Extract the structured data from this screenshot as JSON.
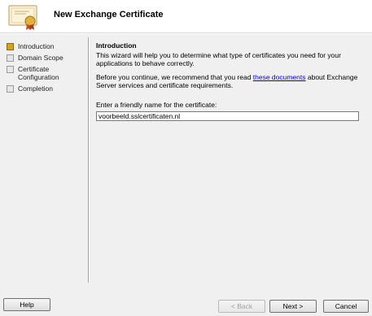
{
  "header": {
    "title": "New Exchange Certificate",
    "icon": "certificate-icon"
  },
  "steps": [
    {
      "label": "Introduction",
      "state": "current"
    },
    {
      "label": "Domain Scope",
      "state": "pending"
    },
    {
      "label": "Certificate Configuration",
      "state": "pending"
    },
    {
      "label": "Completion",
      "state": "pending"
    }
  ],
  "content": {
    "title": "Introduction",
    "intro": "This wizard will help you to determine what type of certificates you need for your applications to behave correctly.",
    "recommend_prefix": "Before you continue, we recommend that you read ",
    "recommend_link": "these documents",
    "recommend_suffix": " about Exchange Server services and certificate requirements.",
    "field_label": "Enter a friendly name for the certificate:",
    "field_value": "voorbeeld.sslcertificaten.nl"
  },
  "buttons": {
    "help": "Help",
    "back": "< Back",
    "next": "Next >",
    "cancel": "Cancel"
  },
  "colors": {
    "active_step": "#d9a21b",
    "link": "#0000ee",
    "header_bg": "#ffffff",
    "body_bg": "#f0f0f0"
  }
}
